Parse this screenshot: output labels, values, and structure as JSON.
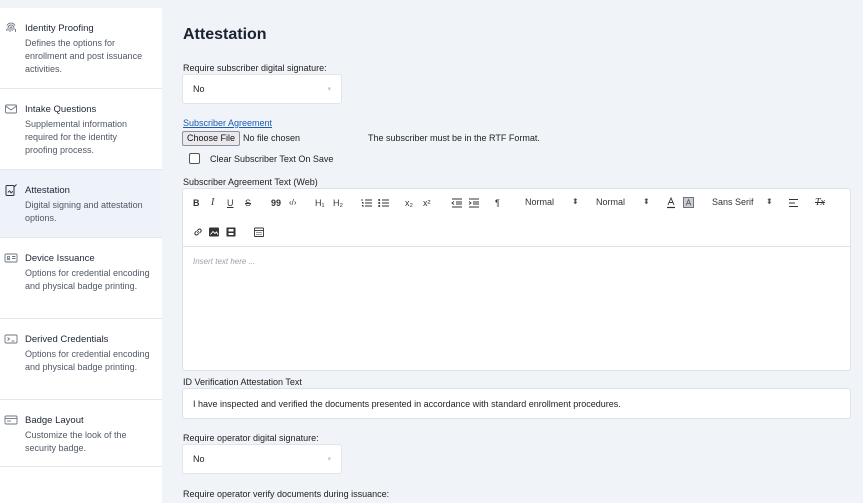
{
  "sidebar": {
    "items": [
      {
        "title": "Identity Proofing",
        "desc": "Defines the options for enrollment and post issuance activities.",
        "icon": "fingerprint-icon"
      },
      {
        "title": "Intake Questions",
        "desc": "Supplemental information required for the identity proofing process.",
        "icon": "envelope-icon"
      },
      {
        "title": "Attestation",
        "desc": "Digital signing and attestation options.",
        "icon": "signature-icon"
      },
      {
        "title": "Device Issuance",
        "desc": "Options for credential encoding and physical badge printing.",
        "icon": "id-card-icon"
      },
      {
        "title": "Derived Credentials",
        "desc": "Options for credential encoding and physical badge printing.",
        "icon": "derived-credential-icon"
      },
      {
        "title": "Badge Layout",
        "desc": "Customize the look of the security badge.",
        "icon": "badge-layout-icon"
      }
    ]
  },
  "main": {
    "title": "Attestation",
    "subscriber_sig": {
      "label": "Require subscriber digital signature:",
      "value": "No"
    },
    "agreement_link": "Subscriber Agreement",
    "file": {
      "button": "Choose File",
      "status": "No file chosen",
      "note": "The subscriber must be in the RTF Format."
    },
    "clear_checkbox": "Clear Subscriber Text On Save",
    "agreement_text_label": "Subscriber Agreement Text (Web)",
    "editor": {
      "placeholder": "Insert text here ...",
      "toolbar": {
        "bold": "B",
        "italic": "I",
        "underline": "U",
        "strike": "S",
        "blockquote": "99",
        "code": "‹/›",
        "h1": "H₁",
        "h2": "H₂",
        "subscript": "x₂",
        "superscript": "x²",
        "rtl": "¶",
        "size1": "Normal",
        "size2": "Normal",
        "font": "Sans Serif",
        "clear": "Tx"
      }
    },
    "id_verification": {
      "label": "ID Verification Attestation Text",
      "value": "I have inspected and verified the documents presented in accordance with standard enrollment procedures."
    },
    "operator_sig": {
      "label": "Require operator digital signature:",
      "value": "No"
    },
    "operator_verify_label": "Require operator verify documents during issuance:"
  }
}
